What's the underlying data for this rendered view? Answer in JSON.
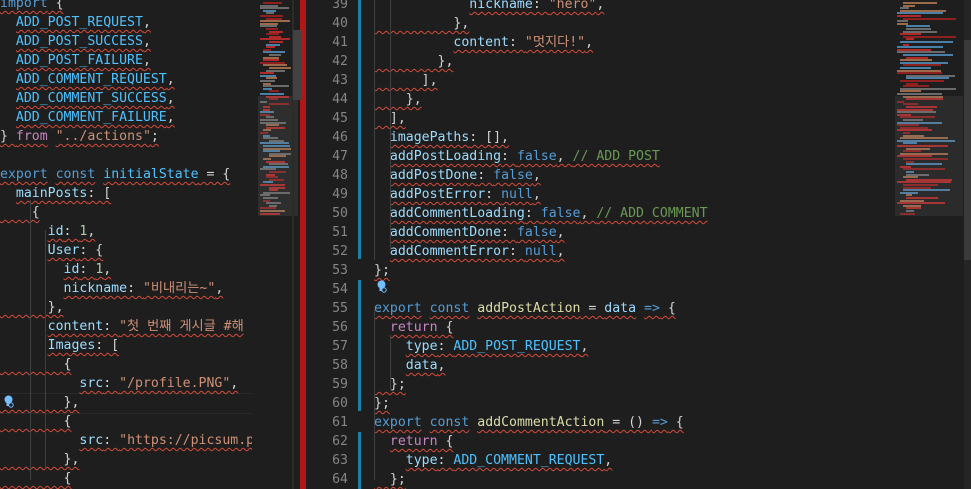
{
  "left_editor": {
    "lines": [
      [
        [
          "kw",
          "import"
        ],
        [
          "p",
          " {"
        ]
      ],
      [
        [
          "p",
          "  "
        ],
        [
          "const",
          "ADD_POST_REQUEST"
        ],
        [
          "p",
          ","
        ]
      ],
      [
        [
          "p",
          "  "
        ],
        [
          "const",
          "ADD_POST_SUCCESS"
        ],
        [
          "p",
          ","
        ]
      ],
      [
        [
          "p",
          "  "
        ],
        [
          "const",
          "ADD_POST_FAILURE"
        ],
        [
          "p",
          ","
        ]
      ],
      [
        [
          "p",
          "  "
        ],
        [
          "const",
          "ADD_COMMENT_REQUEST"
        ],
        [
          "p",
          ","
        ]
      ],
      [
        [
          "p",
          "  "
        ],
        [
          "const",
          "ADD_COMMENT_SUCCESS"
        ],
        [
          "p",
          ","
        ]
      ],
      [
        [
          "p",
          "  "
        ],
        [
          "const",
          "ADD_COMMENT_FAILURE"
        ],
        [
          "p",
          ","
        ]
      ],
      [
        [
          "p",
          "} "
        ],
        [
          "ctl",
          "from"
        ],
        [
          "p",
          " "
        ],
        [
          "str",
          "\"../actions\""
        ],
        [
          "p",
          ";"
        ]
      ],
      [
        [
          "p",
          ""
        ]
      ],
      [
        [
          "kw",
          "export"
        ],
        [
          "p",
          " "
        ],
        [
          "kw",
          "const"
        ],
        [
          "p",
          " "
        ],
        [
          "const",
          "initialState"
        ],
        [
          "p",
          " = {"
        ]
      ],
      [
        [
          "p",
          "  "
        ],
        [
          "var",
          "mainPosts"
        ],
        [
          "p",
          ": ["
        ]
      ],
      [
        [
          "p",
          "    {"
        ]
      ],
      [
        [
          "p",
          "      "
        ],
        [
          "var",
          "id"
        ],
        [
          "p",
          ": "
        ],
        [
          "num",
          "1"
        ],
        [
          "p",
          ","
        ]
      ],
      [
        [
          "p",
          "      "
        ],
        [
          "var",
          "User"
        ],
        [
          "p",
          ": {"
        ]
      ],
      [
        [
          "p",
          "        "
        ],
        [
          "var",
          "id"
        ],
        [
          "p",
          ": "
        ],
        [
          "num",
          "1"
        ],
        [
          "p",
          ","
        ]
      ],
      [
        [
          "p",
          "        "
        ],
        [
          "var",
          "nickname"
        ],
        [
          "p",
          ": "
        ],
        [
          "str",
          "\"비내리는~\""
        ],
        [
          "p",
          ","
        ]
      ],
      [
        [
          "p",
          "      },"
        ]
      ],
      [
        [
          "p",
          "      "
        ],
        [
          "var",
          "content"
        ],
        [
          "p",
          ": "
        ],
        [
          "str",
          "\"첫 번째 게시글 #해"
        ]
      ],
      [
        [
          "p",
          "      "
        ],
        [
          "var",
          "Images"
        ],
        [
          "p",
          ": ["
        ]
      ],
      [
        [
          "p",
          "        {"
        ]
      ],
      [
        [
          "p",
          "          "
        ],
        [
          "var",
          "src"
        ],
        [
          "p",
          ": "
        ],
        [
          "str",
          "\"/profile.PNG\""
        ],
        [
          "p",
          ","
        ]
      ],
      [
        [
          "p",
          "        },"
        ]
      ],
      [
        [
          "p",
          "        {"
        ]
      ],
      [
        [
          "p",
          "          "
        ],
        [
          "var",
          "src"
        ],
        [
          "p",
          ": "
        ],
        [
          "str",
          "\"https://picsum.ph"
        ]
      ],
      [
        [
          "p",
          "        },"
        ]
      ],
      [
        [
          "p",
          "        {"
        ]
      ]
    ]
  },
  "right_editor": {
    "rows": [
      {
        "n": "39",
        "t": [
          [
            "p",
            "            "
          ],
          [
            "var",
            "nickname"
          ],
          [
            "p",
            ": "
          ],
          [
            "str",
            "\"hero\""
          ],
          [
            "p",
            ","
          ]
        ]
      },
      {
        "n": "40",
        "t": [
          [
            "p",
            "          },"
          ]
        ]
      },
      {
        "n": "41",
        "t": [
          [
            "p",
            "          "
          ],
          [
            "var",
            "content"
          ],
          [
            "p",
            ": "
          ],
          [
            "str",
            "\"멋지다!\""
          ],
          [
            "p",
            ","
          ]
        ]
      },
      {
        "n": "42",
        "t": [
          [
            "p",
            "        },"
          ]
        ]
      },
      {
        "n": "43",
        "t": [
          [
            "p",
            "      ],"
          ]
        ]
      },
      {
        "n": "44",
        "t": [
          [
            "p",
            "    },"
          ]
        ]
      },
      {
        "n": "45",
        "t": [
          [
            "p",
            "  ],"
          ]
        ]
      },
      {
        "n": "46",
        "t": [
          [
            "p",
            "  "
          ],
          [
            "var",
            "imagePaths"
          ],
          [
            "p",
            ": [],"
          ]
        ]
      },
      {
        "n": "47",
        "t": [
          [
            "p",
            "  "
          ],
          [
            "var",
            "addPostLoading"
          ],
          [
            "p",
            ": "
          ],
          [
            "kw",
            "false"
          ],
          [
            "p",
            ", "
          ],
          [
            "cm",
            "// ADD POST"
          ]
        ]
      },
      {
        "n": "48",
        "t": [
          [
            "p",
            "  "
          ],
          [
            "var",
            "addPostDone"
          ],
          [
            "p",
            ": "
          ],
          [
            "kw",
            "false"
          ],
          [
            "p",
            ","
          ]
        ]
      },
      {
        "n": "49",
        "t": [
          [
            "p",
            "  "
          ],
          [
            "var",
            "addPostError"
          ],
          [
            "p",
            ": "
          ],
          [
            "kw",
            "null"
          ],
          [
            "p",
            ","
          ]
        ]
      },
      {
        "n": "50",
        "t": [
          [
            "p",
            "  "
          ],
          [
            "var",
            "addCommentLoading"
          ],
          [
            "p",
            ": "
          ],
          [
            "kw",
            "false"
          ],
          [
            "p",
            ", "
          ],
          [
            "cm",
            "// ADD COMMENT"
          ]
        ]
      },
      {
        "n": "51",
        "t": [
          [
            "p",
            "  "
          ],
          [
            "var",
            "addCommentDone"
          ],
          [
            "p",
            ": "
          ],
          [
            "kw",
            "false"
          ],
          [
            "p",
            ","
          ]
        ]
      },
      {
        "n": "52",
        "t": [
          [
            "p",
            "  "
          ],
          [
            "var",
            "addCommentError"
          ],
          [
            "p",
            ": "
          ],
          [
            "kw",
            "null"
          ],
          [
            "p",
            ","
          ]
        ]
      },
      {
        "n": "53",
        "t": [
          [
            "p",
            "};"
          ]
        ]
      },
      {
        "n": "54",
        "t": [
          [
            "p",
            ""
          ]
        ]
      },
      {
        "n": "55",
        "t": [
          [
            "kw",
            "export"
          ],
          [
            "p",
            " "
          ],
          [
            "kw",
            "const"
          ],
          [
            "p",
            " "
          ],
          [
            "fn",
            "addPostAction"
          ],
          [
            "p",
            " = "
          ],
          [
            "var",
            "data"
          ],
          [
            "p",
            " "
          ],
          [
            "kw",
            "=>"
          ],
          [
            "p",
            " {"
          ]
        ]
      },
      {
        "n": "56",
        "t": [
          [
            "p",
            "  "
          ],
          [
            "ctl",
            "return"
          ],
          [
            "p",
            " {"
          ]
        ]
      },
      {
        "n": "57",
        "t": [
          [
            "p",
            "    "
          ],
          [
            "var",
            "type"
          ],
          [
            "p",
            ": "
          ],
          [
            "const",
            "ADD_POST_REQUEST"
          ],
          [
            "p",
            ","
          ]
        ]
      },
      {
        "n": "58",
        "t": [
          [
            "p",
            "    "
          ],
          [
            "var",
            "data"
          ],
          [
            "p",
            ","
          ]
        ]
      },
      {
        "n": "59",
        "t": [
          [
            "p",
            "  };"
          ]
        ]
      },
      {
        "n": "60",
        "t": [
          [
            "p",
            "};"
          ]
        ]
      },
      {
        "n": "61",
        "t": [
          [
            "kw",
            "export"
          ],
          [
            "p",
            " "
          ],
          [
            "kw",
            "const"
          ],
          [
            "p",
            " "
          ],
          [
            "fn",
            "addCommentAction"
          ],
          [
            "p",
            " = () "
          ],
          [
            "kw",
            "=>"
          ],
          [
            "p",
            " {"
          ]
        ]
      },
      {
        "n": "62",
        "t": [
          [
            "p",
            "  "
          ],
          [
            "ctl",
            "return"
          ],
          [
            "p",
            " {"
          ]
        ]
      },
      {
        "n": "63",
        "t": [
          [
            "p",
            "    "
          ],
          [
            "var",
            "type"
          ],
          [
            "p",
            ": "
          ],
          [
            "const",
            "ADD_COMMENT_REQUEST"
          ],
          [
            "p",
            ","
          ]
        ]
      },
      {
        "n": "64",
        "t": [
          [
            "p",
            "  };"
          ]
        ]
      }
    ]
  },
  "icons": {
    "left_lightbulb": "lightbulb-icon",
    "right_lightbulb": "lightbulb-icon"
  },
  "colors": {
    "background": "#1e1e1e",
    "squiggle": "#d64a3a",
    "overview_error": "#b21717",
    "keyword": "#569cd6",
    "string": "#ce9178",
    "comment": "#6a9955"
  }
}
